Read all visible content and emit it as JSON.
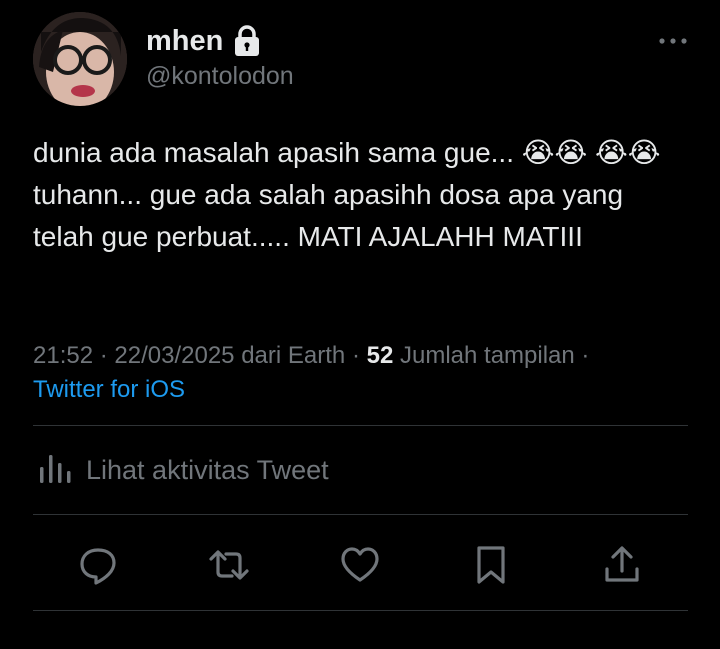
{
  "author": {
    "display_name": "mhen",
    "handle": "@kontolodon",
    "protected_icon": "lock-icon",
    "avatar_icon": "avatar"
  },
  "tweet": {
    "text": "dunia ada masalah apasih sama gue... 😭😭 😭😭 tuhann... gue ada salah apasihh dosa apa yang telah gue perbuat..... MATI AJALAHH MATIII",
    "time": "21:52",
    "date": "22/03/2025",
    "location_text": "dari Earth",
    "views_count": "52",
    "views_label": "Jumlah tampilan",
    "source": "Twitter for iOS",
    "separator": "·"
  },
  "activity": {
    "label": "Lihat aktivitas Tweet",
    "icon": "analytics-bars-icon"
  },
  "actions": [
    {
      "name": "reply-button",
      "icon": "reply-icon"
    },
    {
      "name": "retweet-button",
      "icon": "retweet-icon"
    },
    {
      "name": "like-button",
      "icon": "heart-icon"
    },
    {
      "name": "bookmark-button",
      "icon": "bookmark-icon"
    },
    {
      "name": "share-button",
      "icon": "share-icon"
    }
  ],
  "colors": {
    "background": "#000000",
    "text_primary": "#e7e9ea",
    "text_secondary": "#71767b",
    "link": "#1d9bf0",
    "divider": "#2f3336"
  }
}
